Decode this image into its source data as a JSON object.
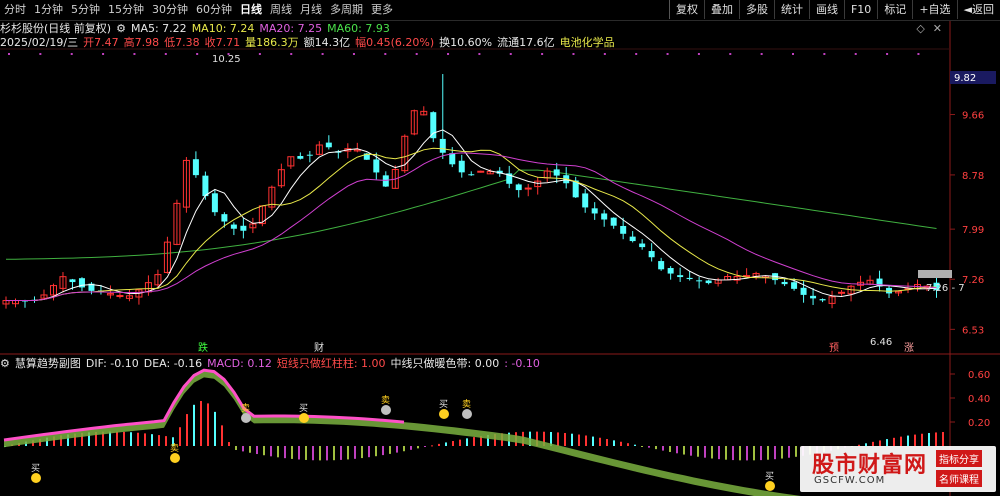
{
  "toolbar": {
    "periods": [
      "分时",
      "1分钟",
      "5分钟",
      "15分钟",
      "30分钟",
      "60分钟",
      "日线",
      "周线",
      "月线",
      "多周期",
      "更多"
    ],
    "active_period": "日线",
    "tools": [
      "复权",
      "叠加",
      "多股",
      "统计",
      "画线",
      "F10",
      "标记",
      "+自选",
      "◄返回"
    ]
  },
  "main_header": {
    "stock": "杉杉股份(日线 前复权)",
    "ma5": "MA5: 7.22",
    "ma10": "MA10: 7.24",
    "ma20": "MA20: 7.25",
    "ma60": "MA60: 7.93"
  },
  "info_bar": {
    "date": "2025/02/19/三",
    "open": "开7.47",
    "high": "高7.98",
    "low": "低7.38",
    "close": "收7.71",
    "volume": "量186.3万",
    "amount": "额14.3亿",
    "amplitude": "幅0.45(6.20%)",
    "turnover": "换10.60%",
    "float": "流通17.6亿",
    "sector": "电池化学品"
  },
  "price_axis": [
    "9.66",
    "8.78",
    "7.99",
    "7.26",
    "6.53"
  ],
  "current_price_tag": "9.82",
  "crosshair_label": "7.26 - 7",
  "annotations": {
    "high_label": "10.25",
    "low_label": "6.46",
    "marker_die": "跌",
    "marker_cai": "财",
    "marker_yu": "预",
    "marker_zhang": "涨"
  },
  "sub_header": {
    "name": "慧算趋势副图",
    "dif": "DIF: -0.10",
    "dea": "DEA: -0.16",
    "macd": "MACD: 0.12",
    "short_only_red": "短线只做红柱柱: 1.00",
    "mid_only_warm": "中线只做暖色带: 0.00",
    "extra": ": -0.10"
  },
  "sub_axis": [
    "0.60",
    "0.40",
    "0.20"
  ],
  "signal_labels": {
    "buy": "买",
    "sell": "卖"
  },
  "colors": {
    "up": "#ff3232",
    "down": "#54ffff",
    "ma5": "#ffffff",
    "ma10": "#e8e84a",
    "ma20": "#d040d0",
    "ma60": "#40b040",
    "ribbon_warm": "#ff50c8",
    "ribbon_cool": "#7ab040"
  },
  "watermark": {
    "title": "股市财富网",
    "url": "GSCFW.COM",
    "tag1": "指标分享",
    "tag2": "名师课程"
  }
}
